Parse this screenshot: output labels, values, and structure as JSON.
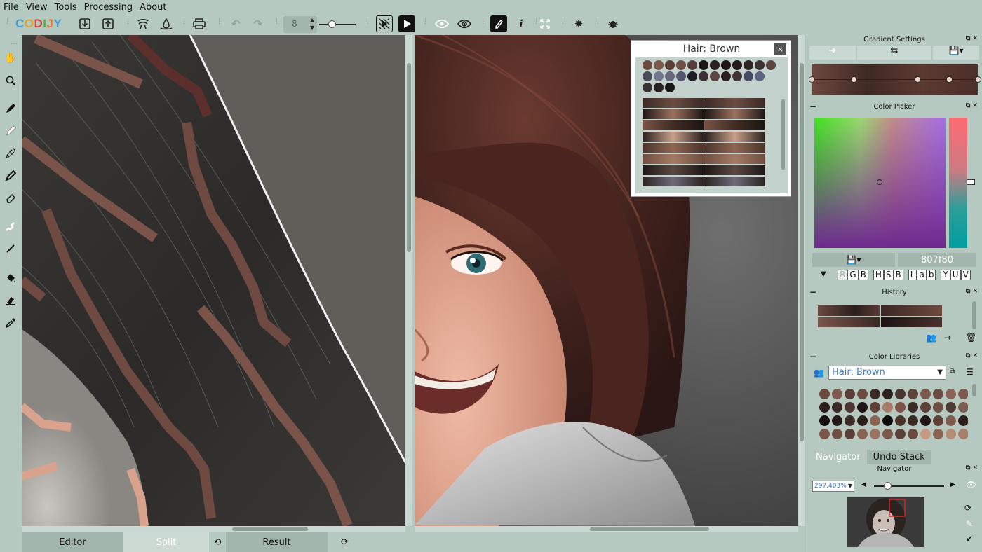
{
  "menu": [
    "File",
    "View",
    "Tools",
    "Processing",
    "About"
  ],
  "toolbar": {
    "logo": "CODIJY",
    "brush_size": "8",
    "icons": [
      "import-icon",
      "export-icon",
      "hair-icon",
      "water-icon",
      "print-icon",
      "undo-icon",
      "redo-icon",
      "recolor-icon",
      "play-icon",
      "eye-icon",
      "mask-eye-icon",
      "pen-icon",
      "info-icon",
      "fit-icon",
      "settings-icon",
      "bug-icon"
    ]
  },
  "left_tools": [
    "pan-icon",
    "zoom-icon",
    "pen-icon",
    "pencil-icon",
    "pattern-pen-icon",
    "marker-icon",
    "eraser-icon",
    "gradient-pen-icon",
    "line-icon",
    "bucket-icon",
    "stamp-icon",
    "eyedropper-icon"
  ],
  "view_tabs": {
    "editor": "Editor",
    "split": "Split",
    "result": "Result"
  },
  "library_popup": {
    "title": "Hair: Brown",
    "close": "×",
    "swatch_rows": [
      [
        "#6a4b40",
        "#7c5a4b",
        "#5a3f34",
        "#6e4f43",
        "#574039",
        "#1a1716",
        "#2a2220",
        "#1c1614",
        "#241a17",
        "#2f2623",
        "#3d3331",
        "#5c4740"
      ],
      [
        "#4a4c5c",
        "#757590",
        "#67677f",
        "#54566d",
        "#1e1c25",
        "#3d3037",
        "#5c4744",
        "#2b2021",
        "#403235",
        "#474a66",
        "#5e6282"
      ],
      [
        "#3a3134",
        "#2b2224",
        "#181616"
      ]
    ],
    "gradient_strips": [
      [
        "#3b2a25",
        "#6a4d42",
        "#3b2a25"
      ],
      [
        "#1e1614",
        "#9b7160",
        "#1e1614"
      ],
      [
        "#7a5545",
        "#402c24",
        "#1b1411"
      ],
      [
        "#2a201d",
        "#c7a08a",
        "#2a201d"
      ],
      [
        "#4b342b",
        "#8d6654",
        "#4b342b"
      ],
      [
        "#6e4e40",
        "#a47a64",
        "#6e4e40"
      ],
      [
        "#1d1716",
        "#5b4843",
        "#1d1716"
      ],
      [
        "#2b2422",
        "#6e6a79",
        "#2b2422"
      ]
    ]
  },
  "gradient_settings": {
    "title": "Gradient Settings",
    "colors": [
      "#6d4a40",
      "#3f2923",
      "#5b3a31",
      "#4b2f28"
    ]
  },
  "color_picker": {
    "title": "Color Picker",
    "hex": "807f80",
    "modes": [
      "R",
      "G",
      "B",
      "H",
      "S",
      "B",
      "L",
      "a",
      "b",
      "Y",
      "U",
      "V"
    ]
  },
  "history": {
    "title": "History"
  },
  "color_libraries": {
    "title": "Color Libraries",
    "selected": "Hair: Brown",
    "swatch_rows": [
      [
        "#6b4a3e",
        "#7d5a4b",
        "#5a3e33",
        "#6d4c40",
        "#3a2a25",
        "#2c211d",
        "#4a3530",
        "#5d4338",
        "#7a5a4d",
        "#6b4a3f",
        "#8a6354",
        "#7d5a4b"
      ],
      [
        "#2a1e1b",
        "#3a2924",
        "#4d3630",
        "#1e1614",
        "#5c4036",
        "#a67b68",
        "#7a5547",
        "#3b2a25",
        "#5b4036",
        "#6d4e42",
        "#4d3a33",
        "#7c5c4f"
      ],
      [
        "#140f0e",
        "#231916",
        "#3d2b25",
        "#2a1f1b",
        "#8b6553",
        "#0d0b0a",
        "#4a332b",
        "#3b2a24",
        "#1f1714",
        "#5e4137",
        "#7e5b4c",
        "#2c201c"
      ],
      [
        "#7c584a",
        "#6e4f42",
        "#5a3f35",
        "#8a6453",
        "#9a7361",
        "#7b5a4b",
        "#5b4137",
        "#6a4a3e",
        "#c59a82",
        "#8a6453",
        "#b58c75",
        "#a87f69"
      ]
    ]
  },
  "navigator": {
    "tab_navigator": "Navigator",
    "tab_undo": "Undo Stack",
    "title": "Navigator",
    "zoom": "297.403%"
  }
}
